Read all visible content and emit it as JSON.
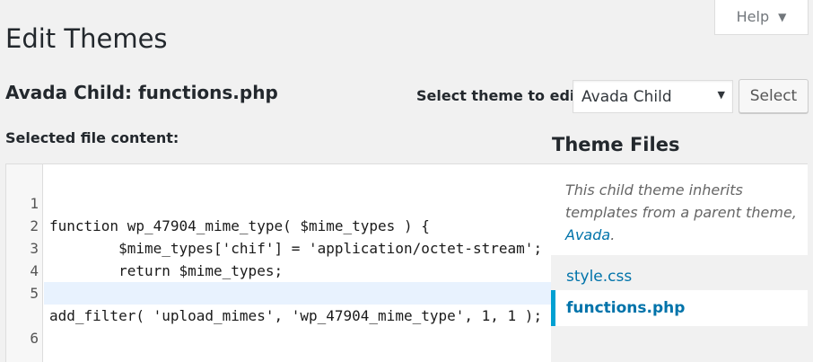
{
  "help": {
    "label": "Help"
  },
  "page": {
    "title": "Edit Themes",
    "file_title": "Avada Child: functions.php",
    "select_label": "Select theme to edit:",
    "selected_theme": "Avada Child",
    "select_button": "Select",
    "content_label": "Selected file content:"
  },
  "editor": {
    "lines": [
      {
        "num": "1",
        "text": "function wp_47904_mime_type( $mime_types ) {"
      },
      {
        "num": "2",
        "text": "        $mime_types['chif'] = 'application/octet-stream';"
      },
      {
        "num": "3",
        "text": "        return $mime_types;"
      },
      {
        "num": "4",
        "text": "}"
      },
      {
        "num": "5",
        "text": "add_filter( 'upload_mimes', 'wp_47904_mime_type', 1, 1 );"
      },
      {
        "num": "6",
        "text": ""
      }
    ],
    "active_line": 6
  },
  "theme_files": {
    "title": "Theme Files",
    "note_prefix": "This child theme inherits templates from a parent theme, ",
    "parent_link": "Avada",
    "note_suffix": ".",
    "files": [
      {
        "label": "style.css",
        "current": false
      },
      {
        "label": "functions.php",
        "current": true
      }
    ]
  },
  "colors": {
    "link": "#0073aa",
    "current_marker": "#00a0d2",
    "active_line_bg": "#e8f2fe"
  }
}
